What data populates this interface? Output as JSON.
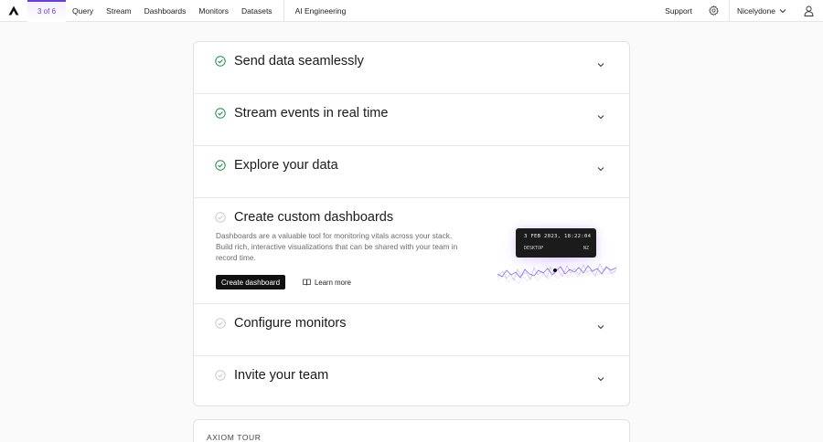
{
  "topbar": {
    "step_badge": "3 of 6",
    "nav": [
      "Query",
      "Stream",
      "Dashboards",
      "Monitors",
      "Datasets",
      "AI Engineering"
    ],
    "support": "Support",
    "org_name": "Nicelydone",
    "icons": [
      "axiom-logo-icon",
      "settings-icon",
      "chevron-down-icon",
      "user-icon"
    ]
  },
  "steps": [
    {
      "title": "Send data seamlessly",
      "completed": true
    },
    {
      "title": "Stream events in real time",
      "completed": true
    },
    {
      "title": "Explore your data",
      "completed": true
    },
    {
      "title": "Create custom dashboards",
      "completed": false,
      "description": "Dashboards are a valuable tool for monitoring vitals across your stack. Build rich, interactive visualizations that can be shared with your team in record time.",
      "primary_button": "Create dashboard",
      "learn_more": "Learn more",
      "tooltip": {
        "date": "3 FEB 2023, 18:22:04",
        "label": "DESKTOP",
        "value": "NZ"
      }
    },
    {
      "title": "Configure monitors",
      "completed": false
    },
    {
      "title": "Invite your team",
      "completed": false
    }
  ],
  "tour": {
    "label": "AXIOM TOUR"
  },
  "colors": {
    "accent": "#6b3fd4",
    "check_done": "#1f8a4c",
    "check_pending": "#c9c9c9",
    "sparkline": "#8b6ae0"
  }
}
